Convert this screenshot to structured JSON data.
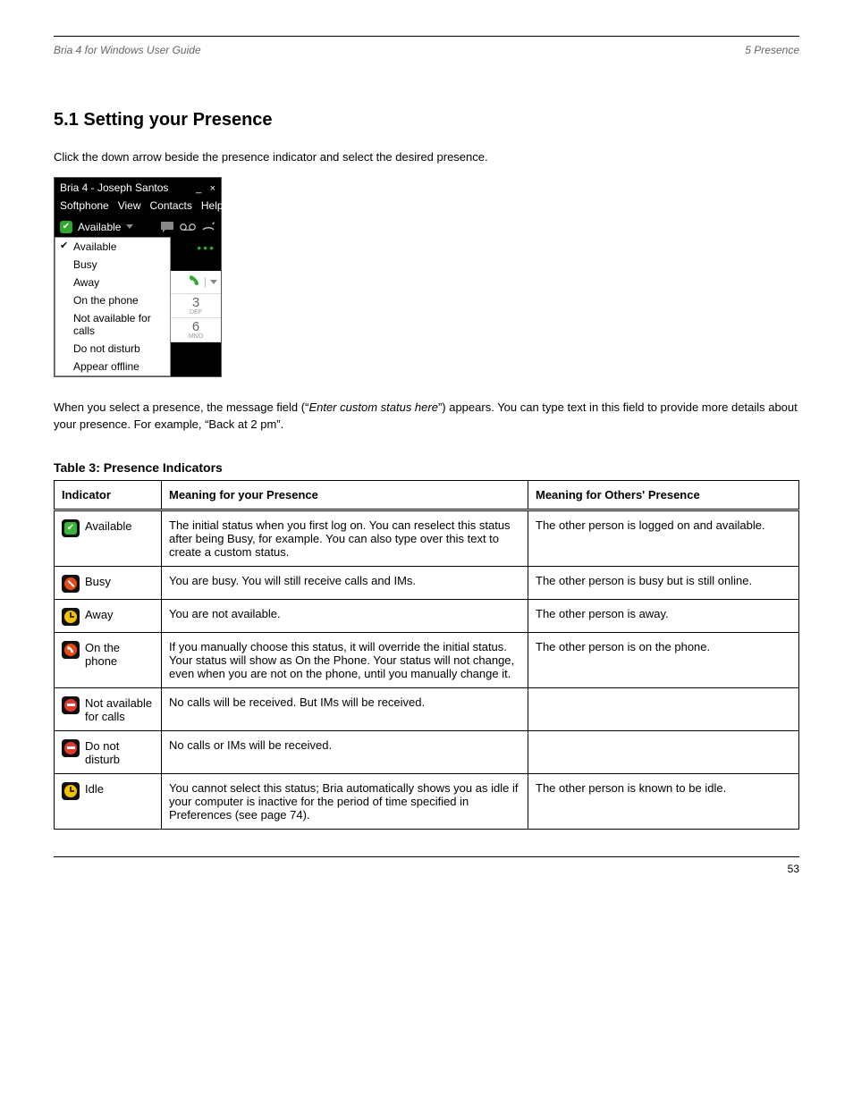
{
  "header": {
    "left": "Bria 4 for Windows User Guide",
    "right": "5  Presence"
  },
  "section_title": "5.1 Setting your Presence",
  "paragraphs": {
    "p1": "Click the down arrow beside the presence indicator and select the desired presence.",
    "p2_prefix": "When you select a presence, the message field (“",
    "p2_em": "Enter custom status here",
    "p2_suffix": "”) appears. You can type text in this field to provide more details about your presence. For example, “Back at 2 pm”.",
    "table_title": "Table 3: Presence Indicators"
  },
  "bria": {
    "title": "Bria 4 - Joseph Santos",
    "menu": [
      "Softphone",
      "View",
      "Contacts",
      "Help"
    ],
    "current_status": "Available",
    "dropdown": [
      "Available",
      "Busy",
      "Away",
      "On the phone",
      "Not available for calls",
      "Do not disturb",
      "Appear offline"
    ],
    "keys": [
      {
        "num": "3",
        "sub": "DEF"
      },
      {
        "num": "6",
        "sub": "MNO"
      }
    ]
  },
  "columns": {
    "c1": "Indicator",
    "c2": "Meaning for your Presence",
    "c3": "Meaning for Others' Presence"
  },
  "rows": [
    {
      "label": "Available",
      "meaning": "The initial status when you first log on. You can reselect this status after being Busy, for example.\nYou can also type over this text to create a custom status.",
      "others": "The other person is logged on and available."
    },
    {
      "label": "Busy",
      "meaning": "You are busy. You will still receive calls and IMs.",
      "others": "The other person is busy but is still online."
    },
    {
      "label": "Away",
      "meaning": "You are not available.",
      "others": "The other person is away."
    },
    {
      "label": "On the phone",
      "meaning": "If you manually choose this status, it will override the initial status. Your status will show as On the Phone. Your status will not change, even when you are not on the phone, until you manually change it.",
      "others": "The other person is on the phone."
    },
    {
      "label": "Not available for calls",
      "meaning": "No calls will be received. But IMs will be received.",
      "others": ""
    },
    {
      "label": "Do not disturb",
      "meaning": "No calls or IMs will be received.",
      "others": ""
    },
    {
      "label": "Idle",
      "meaning": "You cannot select this status; Bria automatically shows you as idle if your computer is inactive for the period of time specified in Preferences (see page 74).",
      "others": "The other person is known to be idle."
    }
  ],
  "footer": {
    "page": "53"
  }
}
